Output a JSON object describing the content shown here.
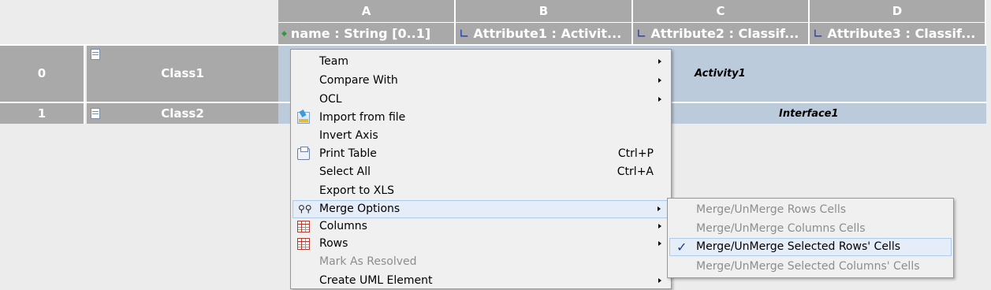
{
  "table": {
    "columns": [
      {
        "letter": "A",
        "header": "name : String [0..1]",
        "icon": "attribute-icon"
      },
      {
        "letter": "B",
        "header": "Attribute1 : Activit...",
        "icon": "relation-icon"
      },
      {
        "letter": "C",
        "header": "Attribute2 : Classif...",
        "icon": "relation-icon"
      },
      {
        "letter": "D",
        "header": "Attribute3 : Classif...",
        "icon": "relation-icon"
      }
    ],
    "rows": [
      {
        "num": "0",
        "name": "Class1",
        "cell_value": "Activity1"
      },
      {
        "num": "1",
        "name": "Class2",
        "cell_value": "Interface1"
      }
    ]
  },
  "context_menu": {
    "items": [
      {
        "label": "Team",
        "submenu": true
      },
      {
        "label": "Compare With",
        "submenu": true
      },
      {
        "label": "OCL",
        "submenu": true
      },
      {
        "label": "Import from file",
        "icon": "import-icon"
      },
      {
        "label": "Invert Axis"
      },
      {
        "label": "Print Table",
        "shortcut": "Ctrl+P",
        "icon": "print-icon"
      },
      {
        "label": "Select All",
        "shortcut": "Ctrl+A"
      },
      {
        "label": "Export to XLS"
      },
      {
        "label": "Merge Options",
        "submenu": true,
        "icon": "binoculars-icon",
        "highlighted": true
      },
      {
        "label": "Columns",
        "submenu": true,
        "icon": "table-icon"
      },
      {
        "label": "Rows",
        "submenu": true,
        "icon": "table-icon"
      },
      {
        "label": "Mark As Resolved",
        "disabled": true
      },
      {
        "label": "Create UML Element",
        "submenu": true
      }
    ]
  },
  "merge_submenu": {
    "items": [
      {
        "label": "Merge/UnMerge Rows Cells",
        "disabled": true
      },
      {
        "label": "Merge/UnMerge Columns Cells",
        "disabled": true
      },
      {
        "label": "Merge/UnMerge Selected Rows' Cells",
        "checked": true
      },
      {
        "label": "Merge/UnMerge Selected Columns' Cells",
        "disabled": true
      }
    ]
  },
  "colors": {
    "header_gray": "#a9a9a9",
    "cell_blue": "#bccbdc",
    "menu_bg": "#f0f0f0",
    "highlight": "#e4edf8"
  }
}
